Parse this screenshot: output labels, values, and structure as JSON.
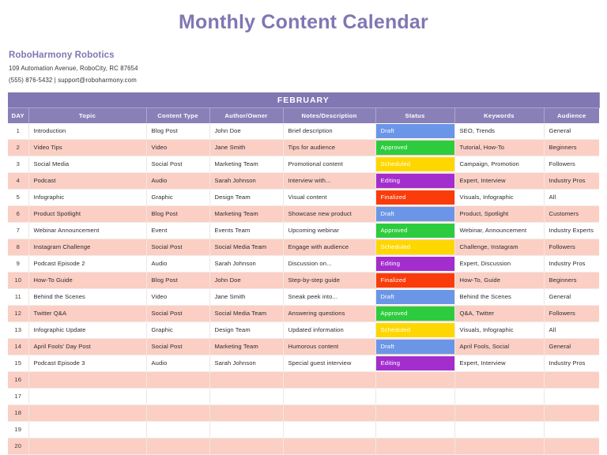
{
  "document": {
    "title": "Monthly Content Calendar"
  },
  "company": {
    "name": "RoboHarmony Robotics",
    "address": "109 Automation Avenue, RoboCity, RC 87654",
    "contact": "(555) 876-5432 | support@roboharmony.com"
  },
  "table": {
    "month": "FEBRUARY",
    "columns": [
      "DAY",
      "Topic",
      "Content Type",
      "Author/Owner",
      "Notes/Description",
      "Status",
      "Keywords",
      "Audience"
    ],
    "status_colors": {
      "Draft": "#6b96e8",
      "Approved": "#2dcc3e",
      "Scheduled": "#ffd700",
      "Editing": "#a32ecd",
      "Finalized": "#fa3c0a"
    },
    "rows": [
      {
        "day": "1",
        "topic": "Introduction",
        "content_type": "Blog Post",
        "author": "John Doe",
        "notes": "Brief description",
        "status": "Draft",
        "keywords": "SEO, Trends",
        "audience": "General"
      },
      {
        "day": "2",
        "topic": "Video Tips",
        "content_type": "Video",
        "author": "Jane Smith",
        "notes": "Tips for audience",
        "status": "Approved",
        "keywords": "Tutorial, How-To",
        "audience": "Beginners"
      },
      {
        "day": "3",
        "topic": "Social Media",
        "content_type": "Social Post",
        "author": "Marketing Team",
        "notes": "Promotional content",
        "status": "Scheduled",
        "keywords": "Campaign, Promotion",
        "audience": "Followers"
      },
      {
        "day": "4",
        "topic": "Podcast",
        "content_type": "Audio",
        "author": "Sarah Johnson",
        "notes": "Interview with...",
        "status": "Editing",
        "keywords": "Expert, Interview",
        "audience": "Industry Pros"
      },
      {
        "day": "5",
        "topic": "Infographic",
        "content_type": "Graphic",
        "author": "Design Team",
        "notes": "Visual content",
        "status": "Finalized",
        "keywords": "Visuals, Infographic",
        "audience": "All"
      },
      {
        "day": "6",
        "topic": "Product Spotlight",
        "content_type": "Blog Post",
        "author": "Marketing Team",
        "notes": "Showcase new product",
        "status": "Draft",
        "keywords": "Product, Spotlight",
        "audience": "Customers"
      },
      {
        "day": "7",
        "topic": "Webinar Announcement",
        "content_type": "Event",
        "author": "Events Team",
        "notes": "Upcoming webinar",
        "status": "Approved",
        "keywords": "Webinar, Announcement",
        "audience": "Industry Experts"
      },
      {
        "day": "8",
        "topic": "Instagram Challenge",
        "content_type": "Social Post",
        "author": "Social Media Team",
        "notes": "Engage with audience",
        "status": "Scheduled",
        "keywords": "Challenge, Instagram",
        "audience": "Followers"
      },
      {
        "day": "9",
        "topic": "Podcast Episode 2",
        "content_type": "Audio",
        "author": "Sarah Johnson",
        "notes": "Discussion on...",
        "status": "Editing",
        "keywords": "Expert, Discussion",
        "audience": "Industry Pros"
      },
      {
        "day": "10",
        "topic": "How-To Guide",
        "content_type": "Blog Post",
        "author": "John Doe",
        "notes": "Step-by-step guide",
        "status": "Finalized",
        "keywords": "How-To, Guide",
        "audience": "Beginners"
      },
      {
        "day": "11",
        "topic": "Behind the Scenes",
        "content_type": "Video",
        "author": "Jane Smith",
        "notes": "Sneak peek into...",
        "status": "Draft",
        "keywords": "Behind the Scenes",
        "audience": "General"
      },
      {
        "day": "12",
        "topic": "Twitter Q&A",
        "content_type": "Social Post",
        "author": "Social Media Team",
        "notes": "Answering questions",
        "status": "Approved",
        "keywords": "Q&A, Twitter",
        "audience": "Followers"
      },
      {
        "day": "13",
        "topic": "Infographic Update",
        "content_type": "Graphic",
        "author": "Design Team",
        "notes": "Updated information",
        "status": "Scheduled",
        "keywords": "Visuals, Infographic",
        "audience": "All"
      },
      {
        "day": "14",
        "topic": "April Fools' Day Post",
        "content_type": "Social Post",
        "author": "Marketing Team",
        "notes": "Humorous content",
        "status": "Draft",
        "keywords": "April Fools, Social",
        "audience": "General"
      },
      {
        "day": "15",
        "topic": "Podcast Episode 3",
        "content_type": "Audio",
        "author": "Sarah Johnson",
        "notes": "Special guest interview",
        "status": "Editing",
        "keywords": "Expert, Interview",
        "audience": "Industry Pros"
      },
      {
        "day": "16",
        "topic": "",
        "content_type": "",
        "author": "",
        "notes": "",
        "status": "",
        "keywords": "",
        "audience": ""
      },
      {
        "day": "17",
        "topic": "",
        "content_type": "",
        "author": "",
        "notes": "",
        "status": "",
        "keywords": "",
        "audience": ""
      },
      {
        "day": "18",
        "topic": "",
        "content_type": "",
        "author": "",
        "notes": "",
        "status": "",
        "keywords": "",
        "audience": ""
      },
      {
        "day": "19",
        "topic": "",
        "content_type": "",
        "author": "",
        "notes": "",
        "status": "",
        "keywords": "",
        "audience": ""
      },
      {
        "day": "20",
        "topic": "",
        "content_type": "",
        "author": "",
        "notes": "",
        "status": "",
        "keywords": "",
        "audience": ""
      }
    ]
  },
  "theme": {
    "accent_purple": "#8177b3",
    "header_purple": "#8a80b8",
    "stripe_pink": "#fbcfc4"
  }
}
